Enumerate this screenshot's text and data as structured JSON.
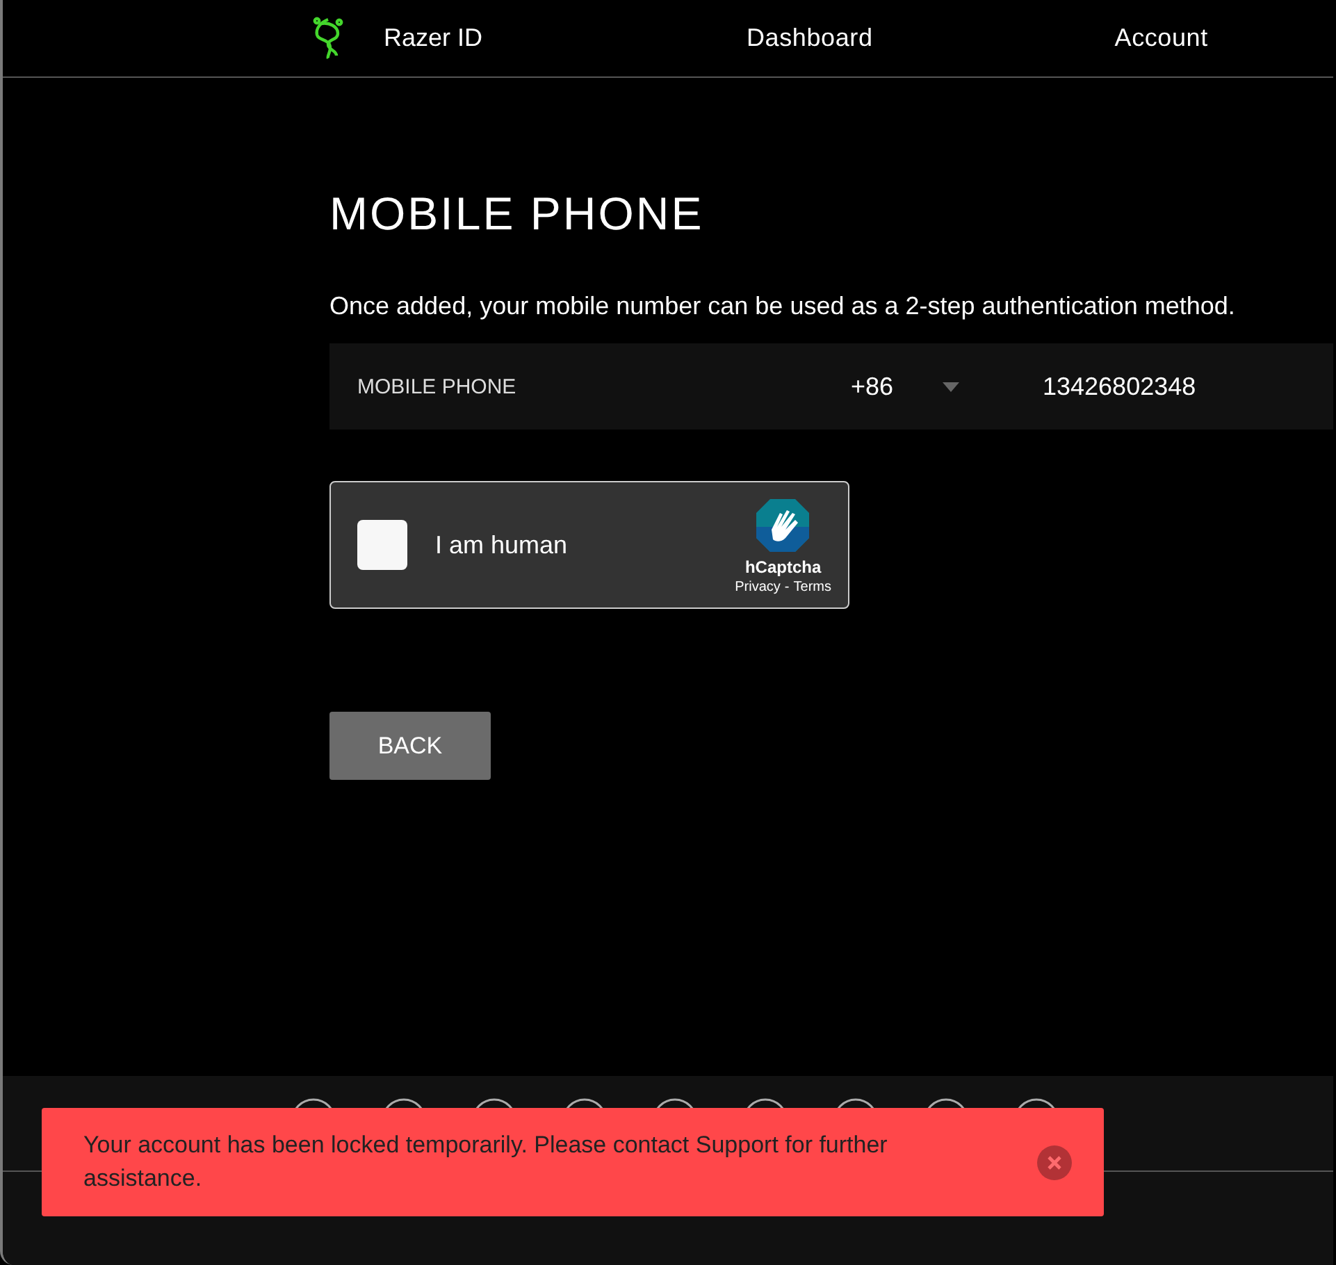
{
  "header": {
    "brand": "Razer ID",
    "nav": [
      {
        "label": "Dashboard"
      },
      {
        "label": "Account"
      }
    ]
  },
  "page": {
    "title": "MOBILE PHONE",
    "description": "Once added, your mobile number can be used as a 2-step authentication method.",
    "phone": {
      "label": "MOBILE PHONE",
      "country_code": "+86",
      "number": "13426802348"
    },
    "captcha": {
      "label": "I am human",
      "checked": false,
      "brand": "hCaptcha",
      "links": [
        "Privacy",
        "Terms"
      ],
      "separator": "-"
    },
    "back_button": "BACK"
  },
  "toast": {
    "kind": "error",
    "message": "Your account has been locked temporarily. Please contact Support for further assistance."
  }
}
